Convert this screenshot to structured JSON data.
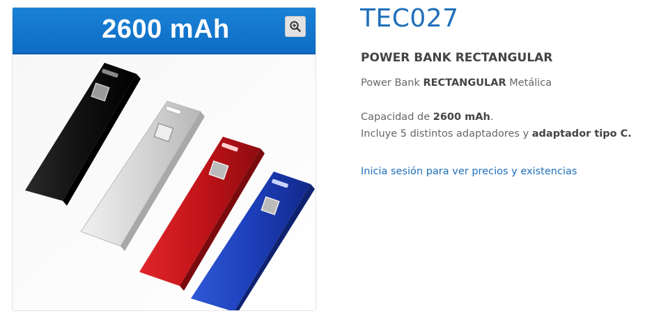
{
  "gallery": {
    "banner_text": "2600 mAh",
    "zoom_icon": "zoom-in-icon"
  },
  "product": {
    "sku": "TEC027",
    "title": "POWER BANK RECTANGULAR",
    "desc_prefix": "Power Bank ",
    "desc_bold": "RECTANGULAR",
    "desc_suffix": " Metálica",
    "cap_line1_prefix": "Capacidad de ",
    "cap_line1_bold": "2600 mAh",
    "cap_line1_suffix": ".",
    "cap_line2_prefix": "Incluye 5 distintos adaptadores y ",
    "cap_line2_bold": "adaptador tipo C.",
    "login_link": "Inicia sesión para ver precios y existencias"
  },
  "colors": {
    "link": "#1e6fba",
    "banner": "#1278cf",
    "product_black": "#1a1a1a",
    "product_silver": "#d8d8d8",
    "product_red": "#c8161d",
    "product_blue": "#1b3fb8"
  }
}
